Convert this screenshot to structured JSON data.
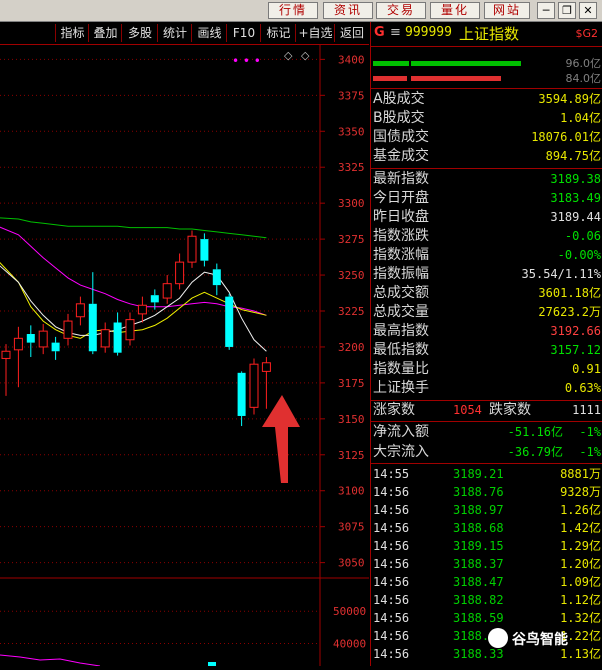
{
  "topbar": {
    "buttons": [
      "行情",
      "资讯",
      "交易",
      "量化",
      "网站"
    ],
    "window_controls": {
      "minimize": "─",
      "restore": "❐",
      "close": "✕"
    }
  },
  "chart_toolbar": {
    "items": [
      "指标",
      "叠加",
      "多股",
      "统计",
      "画线",
      "F10",
      "标记",
      "+自选",
      "返回"
    ],
    "marker_dots": "• • •",
    "diamond": "◇"
  },
  "price_axis": {
    "ticks": [
      "3400",
      "3375",
      "3350",
      "3325",
      "3300",
      "3275",
      "3250",
      "3225",
      "3200",
      "3175",
      "3150",
      "3125",
      "3100",
      "3075",
      "3050"
    ]
  },
  "volume_axis": {
    "ticks": [
      "50000",
      "40000"
    ]
  },
  "quote": {
    "market": "G",
    "menu_glyph": "≡",
    "code": "999999",
    "name": "上证指数",
    "badge": "$G2",
    "bar_values": [
      {
        "label": "96.0亿"
      },
      {
        "label": "84.0亿"
      }
    ],
    "turnover": [
      {
        "label": "A股成交",
        "value": "3594.89",
        "unit": "亿"
      },
      {
        "label": "B股成交",
        "value": "1.04",
        "unit": "亿"
      },
      {
        "label": "国债成交",
        "value": "18076.01",
        "unit": "亿"
      },
      {
        "label": "基金成交",
        "value": "894.75",
        "unit": "亿"
      }
    ],
    "stats": [
      {
        "label": "最新指数",
        "value": "3189.38",
        "color": "#00e000"
      },
      {
        "label": "今日开盘",
        "value": "3183.49",
        "color": "#00e000"
      },
      {
        "label": "昨日收盘",
        "value": "3189.44",
        "color": "#e0e0e0"
      },
      {
        "label": "指数涨跌",
        "value": "-0.06",
        "color": "#00e000"
      },
      {
        "label": "指数涨幅",
        "value": "-0.00%",
        "color": "#00e000"
      },
      {
        "label": "指数振幅",
        "value": "35.54/1.11%",
        "color": "#e0e0e0"
      },
      {
        "label": "总成交额",
        "value": "3601.18亿",
        "color": "#e8e800"
      },
      {
        "label": "总成交量",
        "value": "27623.2万",
        "color": "#e8e800"
      },
      {
        "label": "最高指数",
        "value": "3192.66",
        "color": "#ff4040"
      },
      {
        "label": "最低指数",
        "value": "3157.12",
        "color": "#00e000"
      },
      {
        "label": "指数量比",
        "value": "0.91",
        "color": "#e8e800"
      },
      {
        "label": "上证换手",
        "value": "0.63%",
        "color": "#e8e800"
      }
    ],
    "breadth": {
      "up_label": "涨家数",
      "up_value": "1054",
      "down_label": "跌家数",
      "down_value": "1111"
    },
    "flows": [
      {
        "label": "净流入额",
        "value": "-51.16亿",
        "pct": "-1%"
      },
      {
        "label": "大宗流入",
        "value": "-36.79亿",
        "pct": "-1%"
      }
    ]
  },
  "ticks": [
    {
      "time": "14:55",
      "price": "3189.21",
      "vol": "8881",
      "unit": "万"
    },
    {
      "time": "14:56",
      "price": "3188.76",
      "vol": "9328",
      "unit": "万"
    },
    {
      "time": "14:56",
      "price": "3188.97",
      "vol": "1.26",
      "unit": "亿"
    },
    {
      "time": "14:56",
      "price": "3188.68",
      "vol": "1.42",
      "unit": "亿"
    },
    {
      "time": "14:56",
      "price": "3189.15",
      "vol": "1.29",
      "unit": "亿"
    },
    {
      "time": "14:56",
      "price": "3188.37",
      "vol": "1.20",
      "unit": "亿"
    },
    {
      "time": "14:56",
      "price": "3188.47",
      "vol": "1.09",
      "unit": "亿"
    },
    {
      "time": "14:56",
      "price": "3188.82",
      "vol": "1.12",
      "unit": "亿"
    },
    {
      "time": "14:56",
      "price": "3188.59",
      "vol": "1.32",
      "unit": "亿"
    },
    {
      "time": "14:56",
      "price": "3188.4",
      "vol": "1.22",
      "unit": "亿"
    },
    {
      "time": "14:56",
      "price": "3188.33",
      "vol": "1.13",
      "unit": "亿"
    }
  ],
  "watermark": "谷鸟智能",
  "colors": {
    "up": "#ff2020",
    "down": "#00ffff",
    "ma_white": "#f0f0f0",
    "ma_yellow": "#f0f000",
    "ma_magenta": "#ff00ff",
    "ma_green": "#00c000",
    "axis": "#a00000",
    "arrow": "#e03030"
  },
  "chart_data": {
    "type": "candlestick",
    "ylim": [
      3040,
      3410
    ],
    "candles": [
      {
        "open": 3192,
        "close": 3197,
        "high": 3202,
        "low": 3166
      },
      {
        "open": 3198,
        "close": 3206,
        "high": 3214,
        "low": 3172
      },
      {
        "open": 3209,
        "close": 3203,
        "high": 3215,
        "low": 3193
      },
      {
        "open": 3200,
        "close": 3211,
        "high": 3216,
        "low": 3195
      },
      {
        "open": 3203,
        "close": 3197,
        "high": 3207,
        "low": 3191
      },
      {
        "open": 3206,
        "close": 3218,
        "high": 3223,
        "low": 3201
      },
      {
        "open": 3221,
        "close": 3230,
        "high": 3235,
        "low": 3215
      },
      {
        "open": 3230,
        "close": 3197,
        "high": 3252,
        "low": 3195
      },
      {
        "open": 3200,
        "close": 3212,
        "high": 3217,
        "low": 3196
      },
      {
        "open": 3217,
        "close": 3196,
        "high": 3224,
        "low": 3194
      },
      {
        "open": 3205,
        "close": 3219,
        "high": 3224,
        "low": 3201
      },
      {
        "open": 3223,
        "close": 3229,
        "high": 3235,
        "low": 3217
      },
      {
        "open": 3236,
        "close": 3231,
        "high": 3240,
        "low": 3226
      },
      {
        "open": 3234,
        "close": 3244,
        "high": 3250,
        "low": 3230
      },
      {
        "open": 3244,
        "close": 3259,
        "high": 3265,
        "low": 3240
      },
      {
        "open": 3259,
        "close": 3277,
        "high": 3281,
        "low": 3255
      },
      {
        "open": 3275,
        "close": 3260,
        "high": 3279,
        "low": 3256
      },
      {
        "open": 3254,
        "close": 3243,
        "high": 3258,
        "low": 3236
      },
      {
        "open": 3235,
        "close": 3200,
        "high": 3237,
        "low": 3198
      },
      {
        "open": 3182,
        "close": 3152,
        "high": 3183,
        "low": 3145
      },
      {
        "open": 3158,
        "close": 3188,
        "high": 3192,
        "low": 3153
      },
      {
        "open": 3183,
        "close": 3189,
        "high": 3193,
        "low": 3157
      }
    ],
    "ma_white": [
      3260,
      3245,
      3232,
      3222,
      3214,
      3210,
      3208,
      3208,
      3210,
      3212,
      3215,
      3218,
      3222,
      3228,
      3234,
      3245,
      3252,
      3250,
      3238,
      3220,
      3205,
      3197
    ],
    "ma_yellow": [
      3263,
      3245,
      3228,
      3218,
      3212,
      3208,
      3206,
      3211,
      3212,
      3210,
      3211,
      3212,
      3215,
      3220,
      3227,
      3234,
      3238,
      3234,
      3230,
      3226,
      3224,
      3222
    ],
    "ma_magenta": [
      3285,
      3278,
      3270,
      3262,
      3255,
      3248,
      3243,
      3240,
      3237,
      3233,
      3230,
      3228,
      3228,
      3228,
      3229,
      3230,
      3231,
      3230,
      3228,
      3227,
      3225,
      3222
    ],
    "ma_green": [
      3290,
      3289,
      3287,
      3286,
      3285,
      3284,
      3284,
      3284,
      3284,
      3284,
      3283,
      3283,
      3283,
      3283,
      3282,
      3282,
      3281,
      3280,
      3279,
      3278,
      3277,
      3276
    ],
    "volume_ylim": [
      33000,
      60000
    ]
  }
}
